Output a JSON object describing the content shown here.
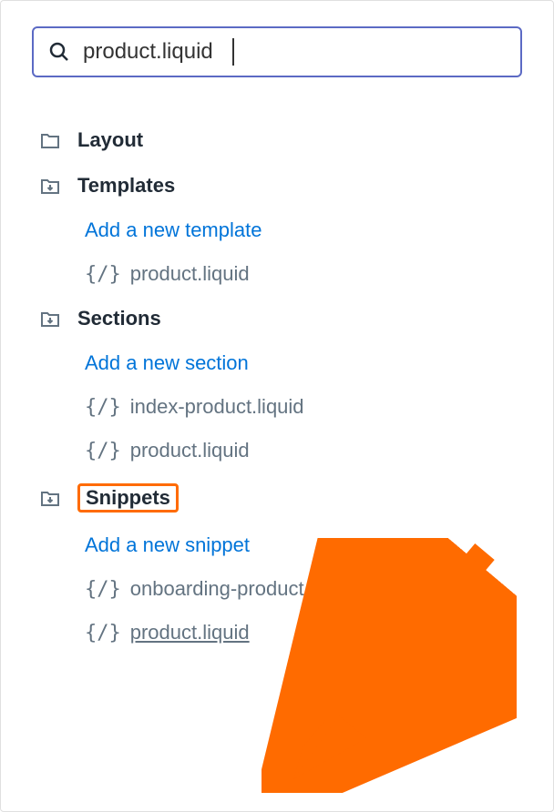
{
  "search": {
    "value": "product.liquid"
  },
  "tree": {
    "layout": {
      "label": "Layout"
    },
    "templates": {
      "label": "Templates",
      "add_link": "Add a new template",
      "files": [
        {
          "icon": "{/}",
          "name": "product.liquid"
        }
      ]
    },
    "sections": {
      "label": "Sections",
      "add_link": "Add a new section",
      "files": [
        {
          "icon": "{/}",
          "name": "index-product.liquid"
        },
        {
          "icon": "{/}",
          "name": "product.liquid"
        }
      ]
    },
    "snippets": {
      "label": "Snippets",
      "add_link": "Add a new snippet",
      "files": [
        {
          "icon": "{/}",
          "name": "onboarding-product.liquid"
        },
        {
          "icon": "{/}",
          "name": "product.liquid"
        }
      ]
    }
  },
  "annotation": {
    "highlight_target": "snippets-label",
    "arrow_target": "snippets-product-liquid",
    "arrow_color": "#ff6b00"
  }
}
